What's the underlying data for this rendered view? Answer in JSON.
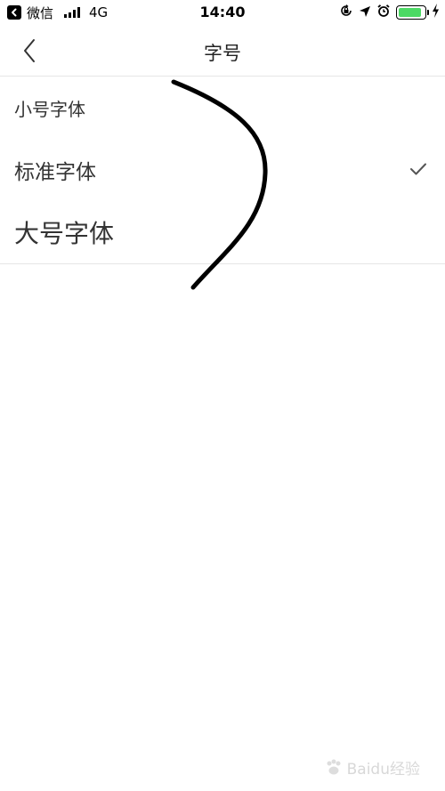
{
  "status_bar": {
    "back_app": "微信",
    "network": "4G",
    "time": "14:40",
    "battery_level": 0.9,
    "icons": [
      "orientation-lock-icon",
      "location-arrow-icon",
      "alarm-icon",
      "battery-icon",
      "charging-bolt-icon"
    ]
  },
  "nav": {
    "title": "字号",
    "back_icon": "chevron-left-icon"
  },
  "options": [
    {
      "label": "小号字体",
      "selected": false
    },
    {
      "label": "标准字体",
      "selected": true
    },
    {
      "label": "大号字体",
      "selected": false
    }
  ],
  "watermark": "Baidu经验",
  "colors": {
    "background": "#ffffff",
    "text": "#333333",
    "divider": "#e6e6e6",
    "battery": "#4cd964",
    "check": "#555555"
  }
}
